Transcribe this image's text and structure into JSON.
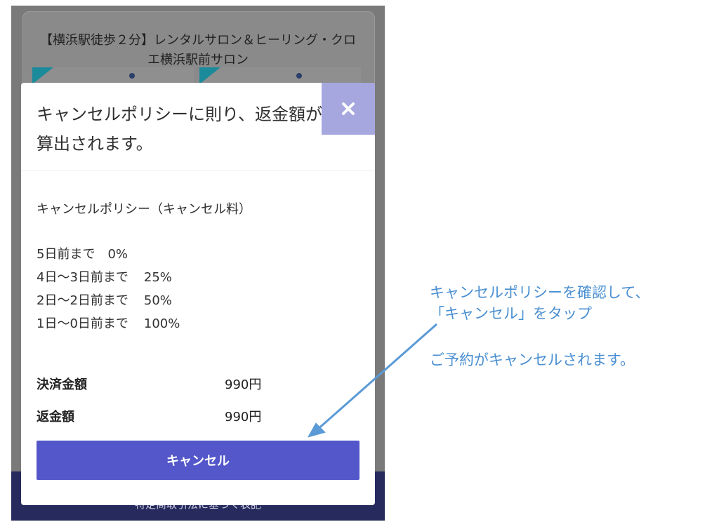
{
  "background": {
    "card_title": "【横浜駅徒歩２分】レンタルサロン＆ヒーリング・クロエ横浜駅前サロン",
    "footer_text": "特定商取引法に基づく表記"
  },
  "modal": {
    "title": "キャンセルポリシーに則り、返金額が算出されます。",
    "close_icon": "close-icon",
    "policy_heading": "キャンセルポリシー（キャンセル料）",
    "policies": [
      {
        "period": "5日前まで",
        "rate": "0%"
      },
      {
        "period": "4日〜3日前まで",
        "rate": "25%"
      },
      {
        "period": "2日〜2日前まで",
        "rate": "50%"
      },
      {
        "period": "1日〜0日前まで",
        "rate": "100%"
      }
    ],
    "payment_label": "決済金額",
    "payment_value": "990円",
    "refund_label": "返金額",
    "refund_value": "990円",
    "cancel_button": "キャンセル"
  },
  "annotation": {
    "line1": "キャンセルポリシーを確認して、",
    "line2": "「キャンセル」をタップ",
    "line3": "ご予約がキャンセルされます。"
  },
  "colors": {
    "overlay": "#7a7a7a",
    "close_button": "#a6a7df",
    "cancel_button": "#5457c9",
    "annotation": "#4a8fd1",
    "footer": "#262a5c"
  }
}
